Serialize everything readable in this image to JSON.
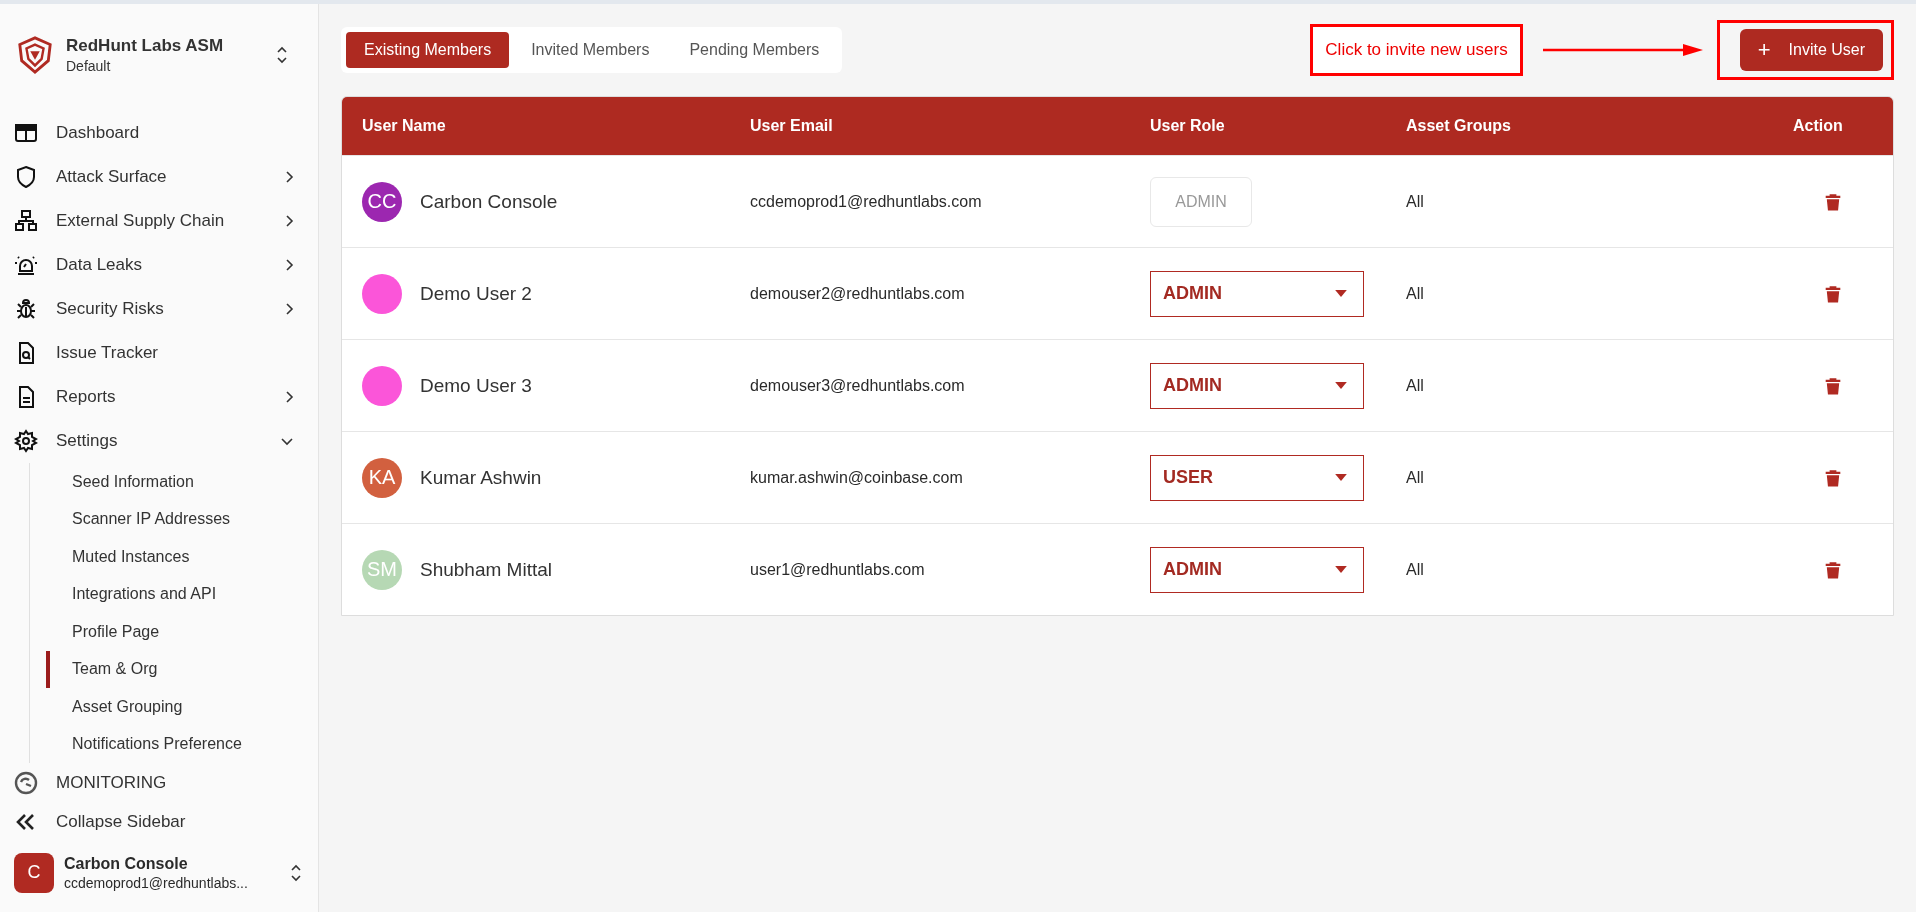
{
  "brand": {
    "name": "RedHunt Labs ASM",
    "workspace": "Default"
  },
  "nav": [
    {
      "label": "Dashboard"
    },
    {
      "label": "Attack Surface",
      "expanded": false
    },
    {
      "label": "External Supply Chain",
      "expanded": false
    },
    {
      "label": "Data Leaks",
      "expanded": false
    },
    {
      "label": "Security Risks",
      "expanded": false
    },
    {
      "label": "Issue Tracker"
    },
    {
      "label": "Reports",
      "expanded": false
    },
    {
      "label": "Settings",
      "expanded": true,
      "children": [
        {
          "label": "Seed Information",
          "selected": false
        },
        {
          "label": "Scanner IP Addresses",
          "selected": false
        },
        {
          "label": "Muted Instances",
          "selected": false
        },
        {
          "label": "Integrations and API",
          "selected": false
        },
        {
          "label": "Profile Page",
          "selected": false
        },
        {
          "label": "Team & Org",
          "selected": true
        },
        {
          "label": "Asset Grouping",
          "selected": false
        },
        {
          "label": "Notifications Preference",
          "selected": false
        }
      ]
    }
  ],
  "monitoring": "MONITORING",
  "collapse": "Collapse Sidebar",
  "account": {
    "initial": "C",
    "name": "Carbon Console",
    "email": "ccdemoprod1@redhuntlabs..."
  },
  "tabs": [
    {
      "label": "Existing Members",
      "selected": true
    },
    {
      "label": "Invited Members",
      "selected": false
    },
    {
      "label": "Pending Members",
      "selected": false
    }
  ],
  "annotation": {
    "text": "Click to invite new users"
  },
  "invite_button": {
    "icon": "+",
    "label": "Invite User"
  },
  "table": {
    "columns": [
      "User Name",
      "User Email",
      "User Role",
      "Asset Groups",
      "Action"
    ],
    "rows": [
      {
        "initials": "CC",
        "color": "#9c27b0",
        "name": "Carbon Console",
        "email": "ccdemoprod1@redhuntlabs.com",
        "role": "ADMIN",
        "disabled": true,
        "groups": "All"
      },
      {
        "color": "#fb55d9",
        "name": "Demo User 2",
        "email": "demouser2@redhuntlabs.com",
        "role": "ADMIN",
        "disabled": false,
        "groups": "All"
      },
      {
        "color": "#fb55d9",
        "name": "Demo User 3",
        "email": "demouser3@redhuntlabs.com",
        "role": "ADMIN",
        "disabled": false,
        "groups": "All"
      },
      {
        "initials": "KA",
        "color": "#d2603f",
        "name": "Kumar Ashwin",
        "email": "kumar.ashwin@coinbase.com",
        "role": "USER",
        "disabled": false,
        "groups": "All"
      },
      {
        "initials": "SM",
        "color": "#b6d8b4",
        "name": "Shubham Mittal",
        "email": "user1@redhuntlabs.com",
        "role": "ADMIN",
        "disabled": false,
        "groups": "All"
      }
    ]
  }
}
